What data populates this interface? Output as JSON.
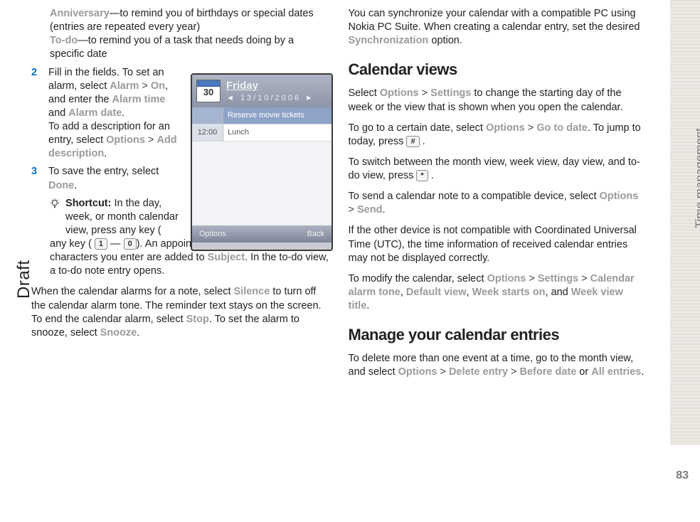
{
  "sideLabel": "Time management",
  "draftLabel": "Draft",
  "pageNumber": "83",
  "left": {
    "anniversaryTerm": "Anniversary",
    "anniversaryDesc": "—to remind you of birthdays or special dates (entries are repeated every year)",
    "todoTerm": "To-do",
    "todoDesc": "—to remind you of a task that needs doing by a specific date",
    "step2Num": "2",
    "step2a": "Fill in the fields. To set an alarm, select ",
    "alarmTerm": "Alarm",
    "gt": " > ",
    "onTerm": "On",
    "step2b": ", and enter the ",
    "alarmTimeTerm": "Alarm time",
    "andWord": " and ",
    "alarmDateTerm": "Alarm date",
    "period": ".",
    "step2c": "To add a description for an entry, select ",
    "optionsTerm": "Options",
    "addDescTerm": "Add description",
    "step3Num": "3",
    "step3a": "To save the entry, select ",
    "doneTerm": "Done",
    "shortcutLabel": "Shortcut:",
    "shortcutA": " In the day, week, or month calendar view, press any key (",
    "key1": "1",
    "dash": " — ",
    "key0": "0",
    "shortcutB": "). An appointment entry opens, and the characters you enter are added to ",
    "subjectTerm": "Subject",
    "shortcutC": ". In the to-do view, a to-do note entry opens.",
    "alarmPara1": "When the calendar alarms for a note, select ",
    "silenceTerm": "Silence",
    "alarmPara2": " to turn off the calendar alarm tone. The reminder text stays on the screen. To end the calendar alarm, select ",
    "stopTerm": "Stop",
    "alarmPara3": ". To set the alarm to snooze, select ",
    "snoozeTerm": "Snooze"
  },
  "phone": {
    "calDay": "30",
    "dayName": "Friday",
    "dateLine": "◄   13/10/2006   ►",
    "row1Time": "",
    "row1Text": "Reserve movie tickets",
    "row2Time": "12:00",
    "row2Text": "Lunch",
    "softLeft": "Options",
    "softRight": "Back"
  },
  "right": {
    "syncPara1": "You can synchronize your calendar with a compatible PC using Nokia PC Suite. When creating a calendar entry, set the desired ",
    "syncTerm": "Synchronization",
    "syncPara2": " option.",
    "heading1": "Calendar views",
    "viewsP1a": "Select ",
    "optionsTerm": "Options",
    "gt": " > ",
    "settingsTerm": "Settings",
    "viewsP1b": " to change the starting day of the week or the view that is shown when you open the calendar.",
    "gotoP1a": "To go to a certain date, select ",
    "gotoDateTerm": "Go to date",
    "gotoP1b": ". To jump to today, press ",
    "hashKey": "#",
    "gotoP1c": " .",
    "switchP1a": "To switch between the month view, week view, day view, and to-do view, press ",
    "starKey": "*",
    "switchP1b": " .",
    "sendP1a": "To send a calendar note to a compatible device, select ",
    "sendTerm": "Send",
    "period": ".",
    "utcPara": "If the other device is not compatible with Coordinated Universal Time (UTC), the time information of received calendar entries may not be displayed correctly.",
    "modifyP1a": "To modify the calendar, select ",
    "calAlarmTerm": "Calendar alarm tone",
    "comma": ", ",
    "defaultViewTerm": "Default view",
    "weekStartsTerm": "Week starts on",
    "andWord": ", and ",
    "weekViewTitleTerm": "Week view title",
    "heading2": "Manage your calendar entries",
    "deleteP1a": "To delete more than one event at a time, go to the month view, and select ",
    "deleteEntryTerm": "Delete entry",
    "beforeDateTerm": "Before date",
    "orWord": " or ",
    "allEntriesTerm": "All entries"
  }
}
